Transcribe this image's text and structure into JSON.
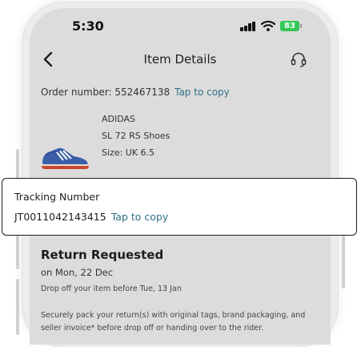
{
  "status_bar": {
    "time": "5:30",
    "battery": "83",
    "battery_color": "#34c759"
  },
  "header": {
    "title": "Item Details",
    "back_icon": "chevron-left-icon",
    "support_icon": "headset-icon"
  },
  "order": {
    "label": "Order number: 552467138",
    "copy_label": "Tap to copy"
  },
  "product": {
    "brand": "ADIDAS",
    "name": "SL 72 RS Shoes",
    "size": "Size: UK 6.5",
    "image_icon": "sneaker-icon"
  },
  "tracking": {
    "label": "Tracking Number",
    "number": "JT0011042143415",
    "copy_label": "Tap to copy"
  },
  "return_info": {
    "title": "Return Requested",
    "date": "on Mon, 22 Dec",
    "note": "Drop off your item before Tue, 13 Jan",
    "instructions": "Securely pack your return(s) with original tags, brand packaging, and seller invoice* before drop off or handing over to the rider."
  },
  "colors": {
    "link": "#2e6f88",
    "screen_background": "#dcdcdc",
    "card_background": "#ffffff"
  }
}
